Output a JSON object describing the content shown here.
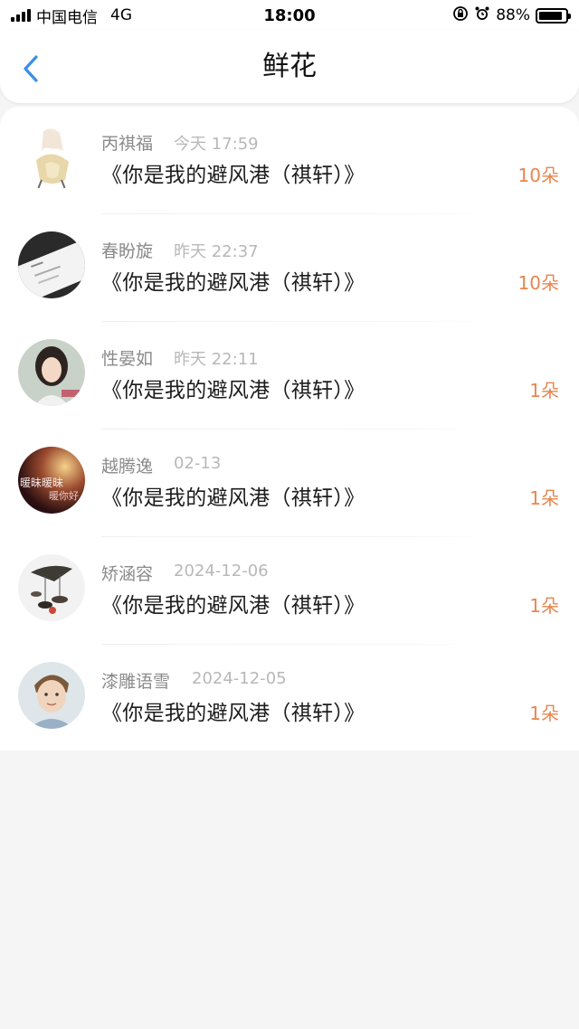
{
  "status_bar": {
    "carrier": "中国电信",
    "network": "4G",
    "time": "18:00",
    "battery_percent": "88%",
    "battery_level": 0.88
  },
  "nav": {
    "title": "鲜花",
    "back_icon": "chevron-left-icon",
    "accent_color": "#3a8ee6"
  },
  "list": {
    "count_color": "#e8864f",
    "items": [
      {
        "name": "丙祺福",
        "time": "今天 17:59",
        "title": "《你是我的避风港（祺轩）》",
        "count": "10朵"
      },
      {
        "name": "春盼旋",
        "time": "昨天 22:37",
        "title": "《你是我的避风港（祺轩）》",
        "count": "10朵"
      },
      {
        "name": "性晏如",
        "time": "昨天 22:11",
        "title": "《你是我的避风港（祺轩）》",
        "count": "1朵"
      },
      {
        "name": "越腾逸",
        "time": "02-13",
        "title": "《你是我的避风港（祺轩）》",
        "count": "1朵",
        "avatar_text_1": "暖昧暖昧",
        "avatar_text_2": "暖你好"
      },
      {
        "name": "矫涵容",
        "time": "2024-12-06",
        "title": "《你是我的避风港（祺轩）》",
        "count": "1朵"
      },
      {
        "name": "漆雕语雪",
        "time": "2024-12-05",
        "title": "《你是我的避风港（祺轩）》",
        "count": "1朵"
      }
    ]
  }
}
